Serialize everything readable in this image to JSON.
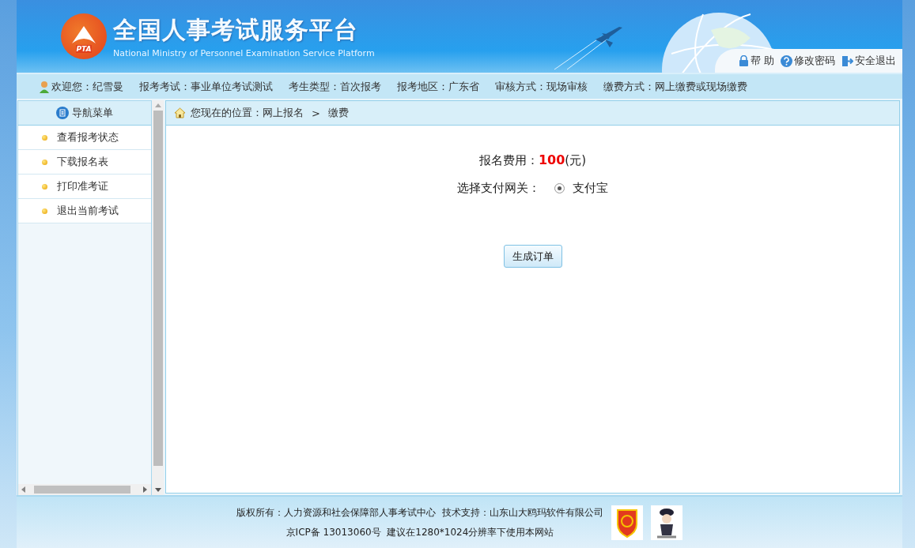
{
  "header": {
    "logo_text": "PTA",
    "title": "全国人事考试服务平台",
    "subtitle": "National Ministry of Personnel Examination Service Platform",
    "links": [
      {
        "label": "帮 助",
        "kind": "lock"
      },
      {
        "label": "修改密码",
        "kind": "question"
      },
      {
        "label": "安全退出",
        "kind": "exit"
      }
    ]
  },
  "info_bar": {
    "welcome": "欢迎您：纪雪曼",
    "items": [
      "报考考试：事业单位考试测试",
      "考生类型：首次报考",
      "报考地区：广东省",
      "审核方式：现场审核",
      "缴费方式：网上缴费或现场缴费"
    ]
  },
  "sidebar": {
    "title": "导航菜单",
    "items": [
      {
        "label": "查看报考状态"
      },
      {
        "label": "下载报名表"
      },
      {
        "label": "打印准考证"
      },
      {
        "label": "退出当前考试"
      }
    ]
  },
  "breadcrumb": {
    "prefix": "您现在的位置：网上报名",
    "separator": ">",
    "current": "缴费"
  },
  "payment": {
    "fee_label": "报名费用：",
    "fee_amount": "100",
    "fee_unit": "(元)",
    "gateway_label": "选择支付网关：",
    "gateways": [
      {
        "label": "支付宝",
        "selected": true
      }
    ],
    "submit": "生成订单"
  },
  "footer": {
    "line_1": "版权所有：人力资源和社会保障部人事考试中心  技术支持：山东山大鸥玛软件有限公司",
    "line_2": "京ICP备 13013060号  建议在1280*1024分辨率下使用本网站"
  }
}
